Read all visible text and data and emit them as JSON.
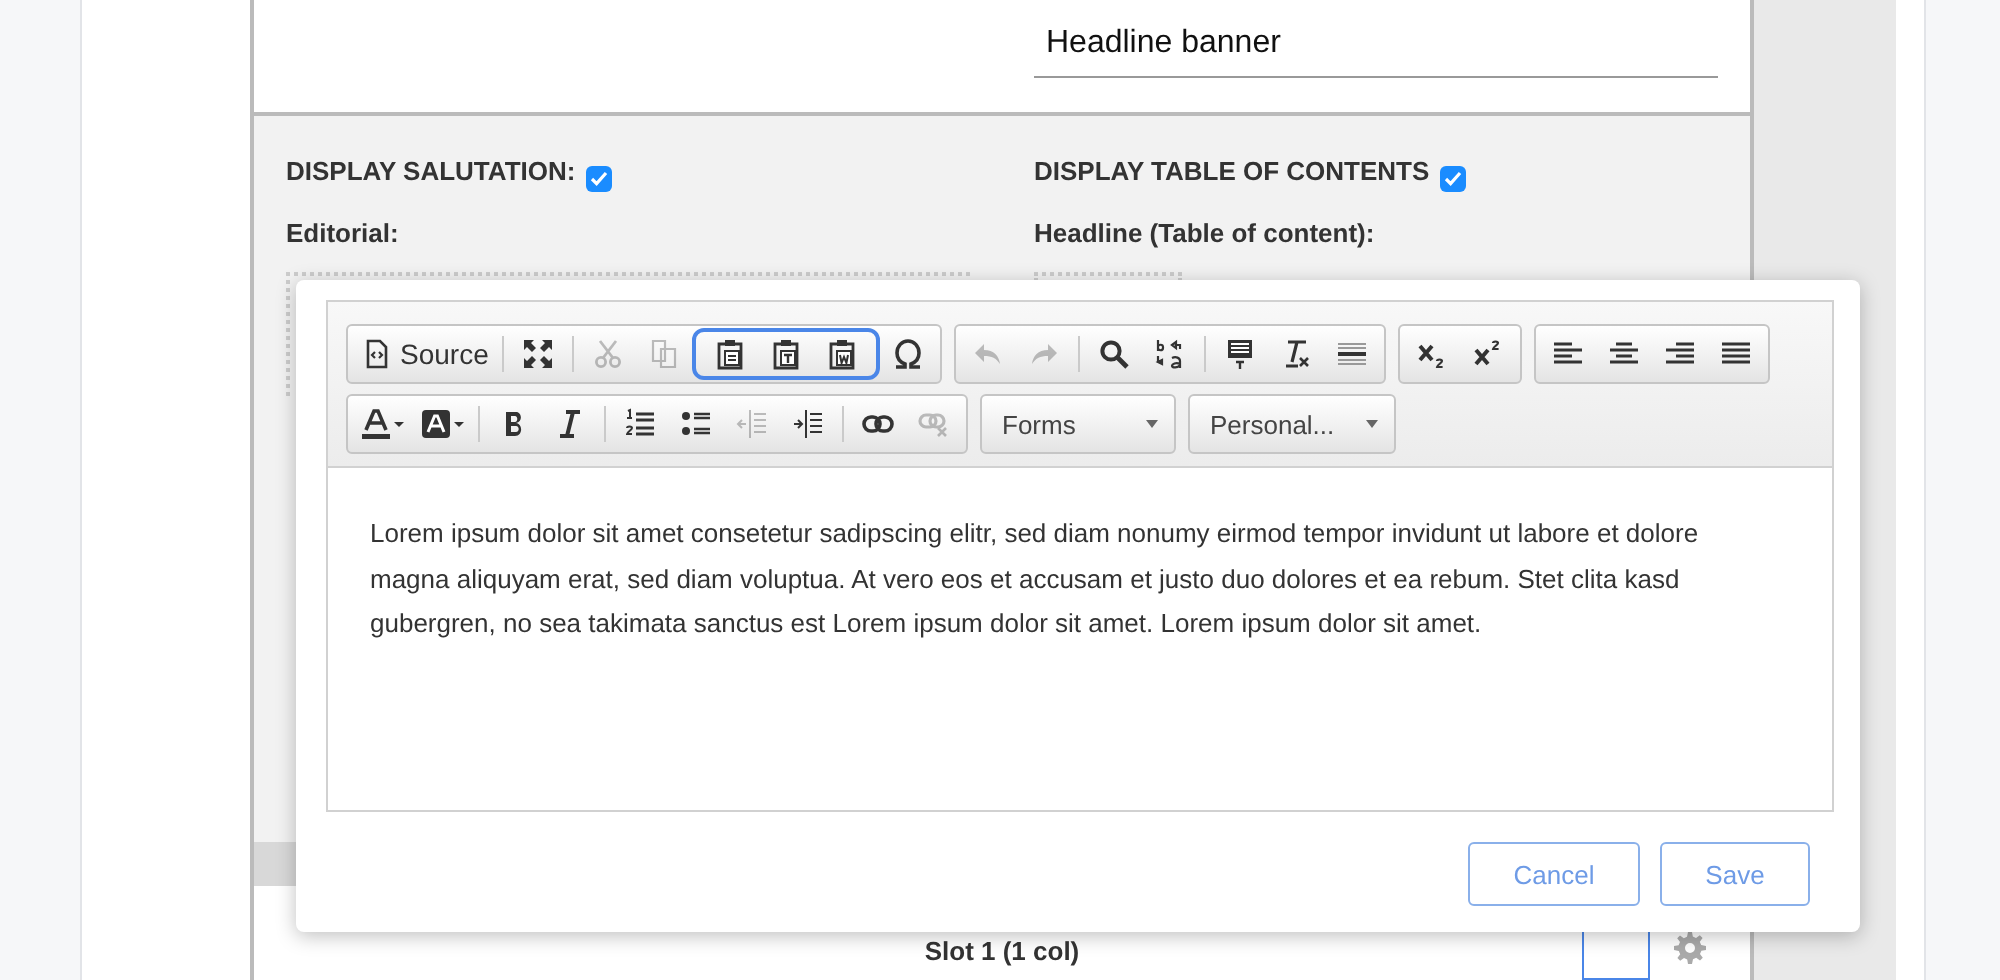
{
  "page": {
    "headline_field": {
      "value": "Headline banner"
    },
    "left_column": {
      "label": "DISPLAY SALUTATION:",
      "checked": true,
      "field_label": "Editorial:"
    },
    "right_column": {
      "label": "DISPLAY TABLE OF CONTENTS",
      "checked": true,
      "field_label": "Headline (Table of content):"
    },
    "slot_title": "Slot 1 (1 col)"
  },
  "dialog": {
    "toolbar_rows": [
      [
        {
          "kind": "group",
          "items": [
            {
              "kind": "button",
              "label": "Source",
              "disabled": false
            },
            {
              "kind": "separator"
            },
            {
              "kind": "button",
              "disabled": false
            },
            {
              "kind": "separator"
            },
            {
              "kind": "button",
              "disabled": true
            },
            {
              "kind": "button",
              "disabled": true
            },
            {
              "kind": "highlight",
              "items": [
                {
                  "kind": "button",
                  "disabled": false
                },
                {
                  "kind": "button",
                  "disabled": false
                },
                {
                  "kind": "button",
                  "disabled": false
                }
              ]
            },
            {
              "kind": "button",
              "disabled": false
            }
          ]
        },
        {
          "kind": "group",
          "items": [
            {
              "kind": "button",
              "disabled": true
            },
            {
              "kind": "button",
              "disabled": true
            },
            {
              "kind": "separator"
            },
            {
              "kind": "button",
              "disabled": false
            },
            {
              "kind": "button",
              "disabled": false
            },
            {
              "kind": "separator"
            },
            {
              "kind": "button",
              "disabled": false
            },
            {
              "kind": "button",
              "disabled": false
            },
            {
              "kind": "button",
              "disabled": false
            }
          ]
        },
        {
          "kind": "group",
          "items": [
            {
              "kind": "button",
              "disabled": false
            },
            {
              "kind": "button",
              "disabled": false
            }
          ]
        },
        {
          "kind": "group",
          "items": [
            {
              "kind": "button",
              "disabled": false
            },
            {
              "kind": "button",
              "disabled": false
            },
            {
              "kind": "button",
              "disabled": false
            },
            {
              "kind": "button",
              "disabled": false
            }
          ]
        }
      ],
      [
        {
          "kind": "group",
          "items": [
            {
              "kind": "button",
              "disabled": false
            },
            {
              "kind": "button",
              "disabled": false
            },
            {
              "kind": "separator"
            },
            {
              "kind": "button",
              "disabled": false
            },
            {
              "kind": "button",
              "disabled": false
            },
            {
              "kind": "separator"
            },
            {
              "kind": "button",
              "disabled": false
            },
            {
              "kind": "button",
              "disabled": false
            },
            {
              "kind": "button",
              "disabled": true
            },
            {
              "kind": "button",
              "disabled": false
            },
            {
              "kind": "separator"
            },
            {
              "kind": "button",
              "disabled": false
            },
            {
              "kind": "button",
              "disabled": true
            }
          ]
        },
        {
          "kind": "combo",
          "label": "Forms"
        },
        {
          "kind": "combo",
          "label": "Personal..."
        }
      ]
    ],
    "content": "Lorem ipsum dolor sit amet consetetur sadipscing elitr, sed diam nonumy eirmod tempor invidunt ut labore et dolore magna aliquyam erat, sed diam voluptua. At vero eos et accusam et justo duo dolores et ea rebum. Stet clita kasd gubergren, no sea takimata sanctus est Lorem ipsum dolor sit amet. Lorem ipsum dolor sit amet.",
    "buttons": [
      {
        "label": "Cancel"
      },
      {
        "label": "Save"
      }
    ]
  }
}
